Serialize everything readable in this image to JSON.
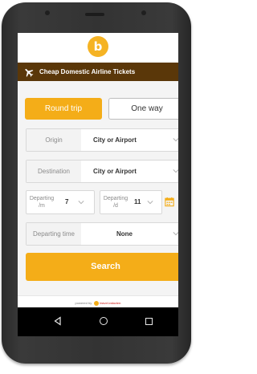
{
  "header": {
    "logo_glyph": "b",
    "title": "Cheap Domestic Airline Tickets",
    "plane_icon": "airplane-icon"
  },
  "trip_type": {
    "round_trip_label": "Round trip",
    "one_way_label": "One way",
    "selected": "Round trip"
  },
  "form": {
    "origin": {
      "label": "Origin",
      "value": "City or Airport"
    },
    "destination": {
      "label": "Destination",
      "value": "City or Airport"
    },
    "departing_month": {
      "label": "Departing /m",
      "value": "7"
    },
    "departing_day": {
      "label": "Departing /d",
      "value": "11"
    },
    "departing_time": {
      "label": "Departing time",
      "value": "None"
    },
    "calendar_icon": "calendar-icon"
  },
  "search_button_label": "Search",
  "footer": {
    "powered_by": "powered by",
    "brand": "travel.rakuten"
  },
  "colors": {
    "accent": "#f4ad18",
    "title_bar": "#5a3709"
  },
  "navbar": {
    "back_icon": "back-icon",
    "home_icon": "home-icon",
    "recents_icon": "recents-icon"
  }
}
